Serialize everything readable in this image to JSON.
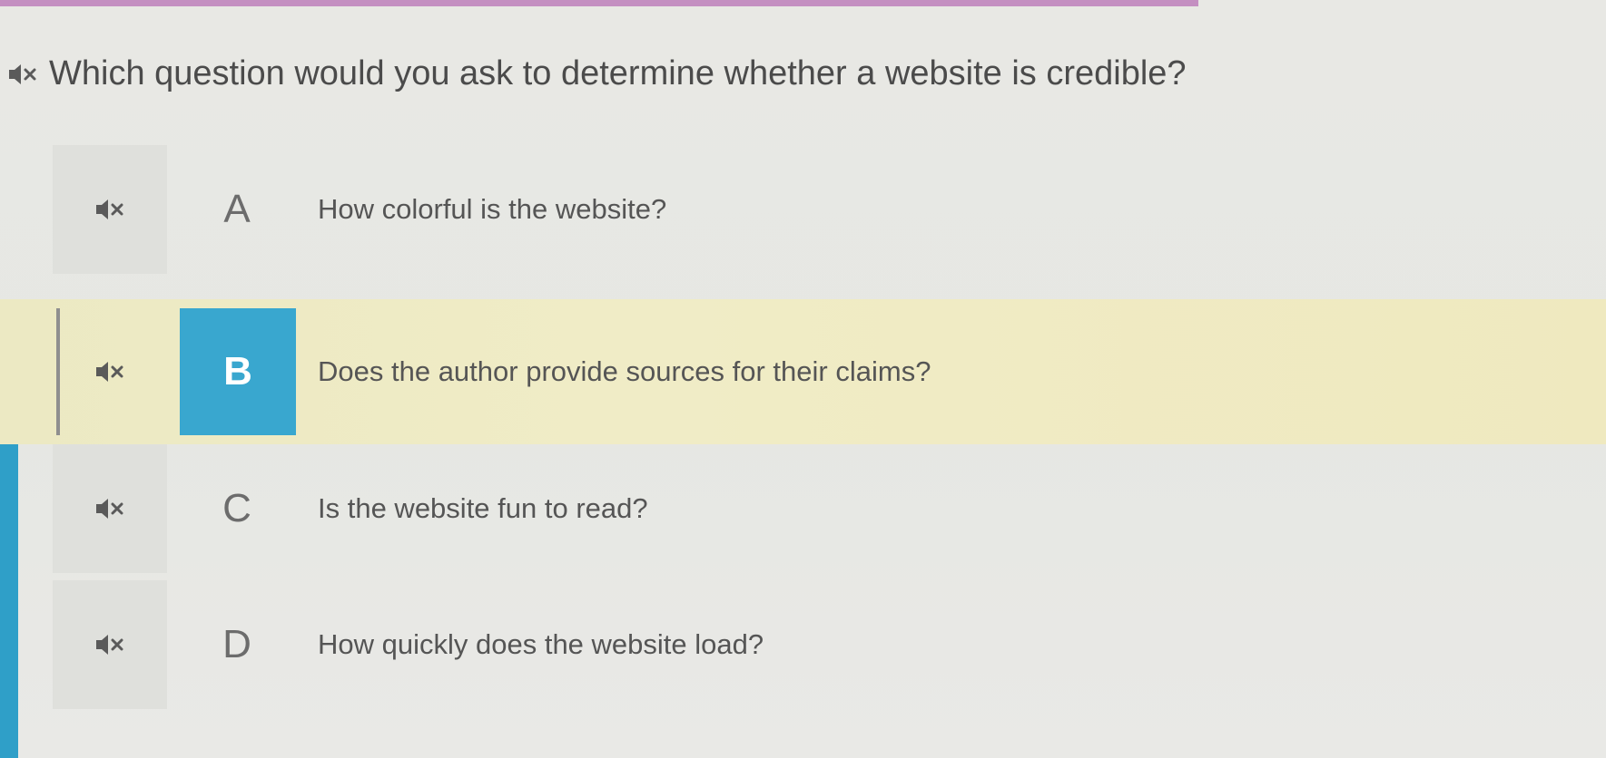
{
  "question": {
    "text": "Which question would you ask to determine whether a website is credible?",
    "icon": "speaker-mute-icon"
  },
  "options": [
    {
      "letter": "A",
      "text": "How colorful is the website?",
      "selected": false
    },
    {
      "letter": "B",
      "text": "Does the author provide sources for their claims?",
      "selected": true
    },
    {
      "letter": "C",
      "text": "Is the website fun to read?",
      "selected": false
    },
    {
      "letter": "D",
      "text": "How quickly does the website load?",
      "selected": false
    }
  ],
  "colors": {
    "accent_blue": "#39a7cf",
    "selected_row": "#efebc4",
    "top_bar": "#c48fc1",
    "background": "#e7e7e3"
  }
}
